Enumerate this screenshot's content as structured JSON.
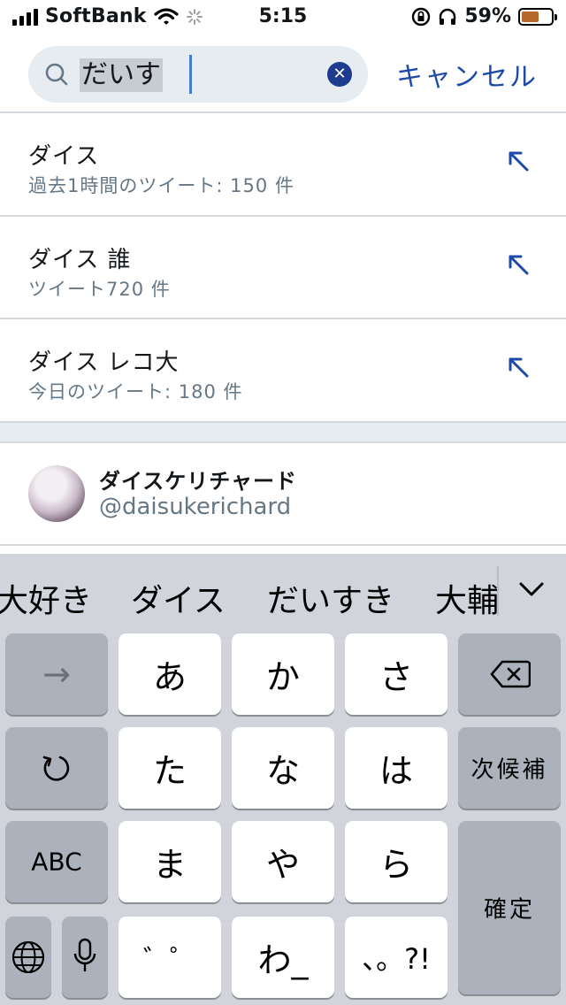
{
  "status_bar": {
    "carrier": "SoftBank",
    "time": "5:15",
    "battery": "59%",
    "battery_level": 0.59
  },
  "search": {
    "query": "だいす",
    "cancel_label": "キャンセル"
  },
  "suggestions": [
    {
      "title": "ダイス",
      "subtitle": "過去1時間のツイート: 150 件"
    },
    {
      "title": "ダイス 誰",
      "subtitle": "ツイート720 件"
    },
    {
      "title": "ダイス レコ大",
      "subtitle": "今日のツイート: 180 件"
    }
  ],
  "user_result": {
    "name": "ダイスケリチャード",
    "handle": "@daisukerichard"
  },
  "keyboard": {
    "candidates": [
      "大好き",
      "ダイス",
      "だいすき",
      "大輔"
    ],
    "keys": {
      "arrow": "→",
      "a": "あ",
      "ka": "か",
      "sa": "さ",
      "ta": "た",
      "na": "な",
      "ha": "は",
      "abc": "ABC",
      "ma": "ま",
      "ya": "や",
      "ra": "ら",
      "dakuten": "゛゜",
      "wa": "わ_",
      "punct": "、。?!",
      "next_candidate": "次候補",
      "confirm": "確定"
    }
  }
}
